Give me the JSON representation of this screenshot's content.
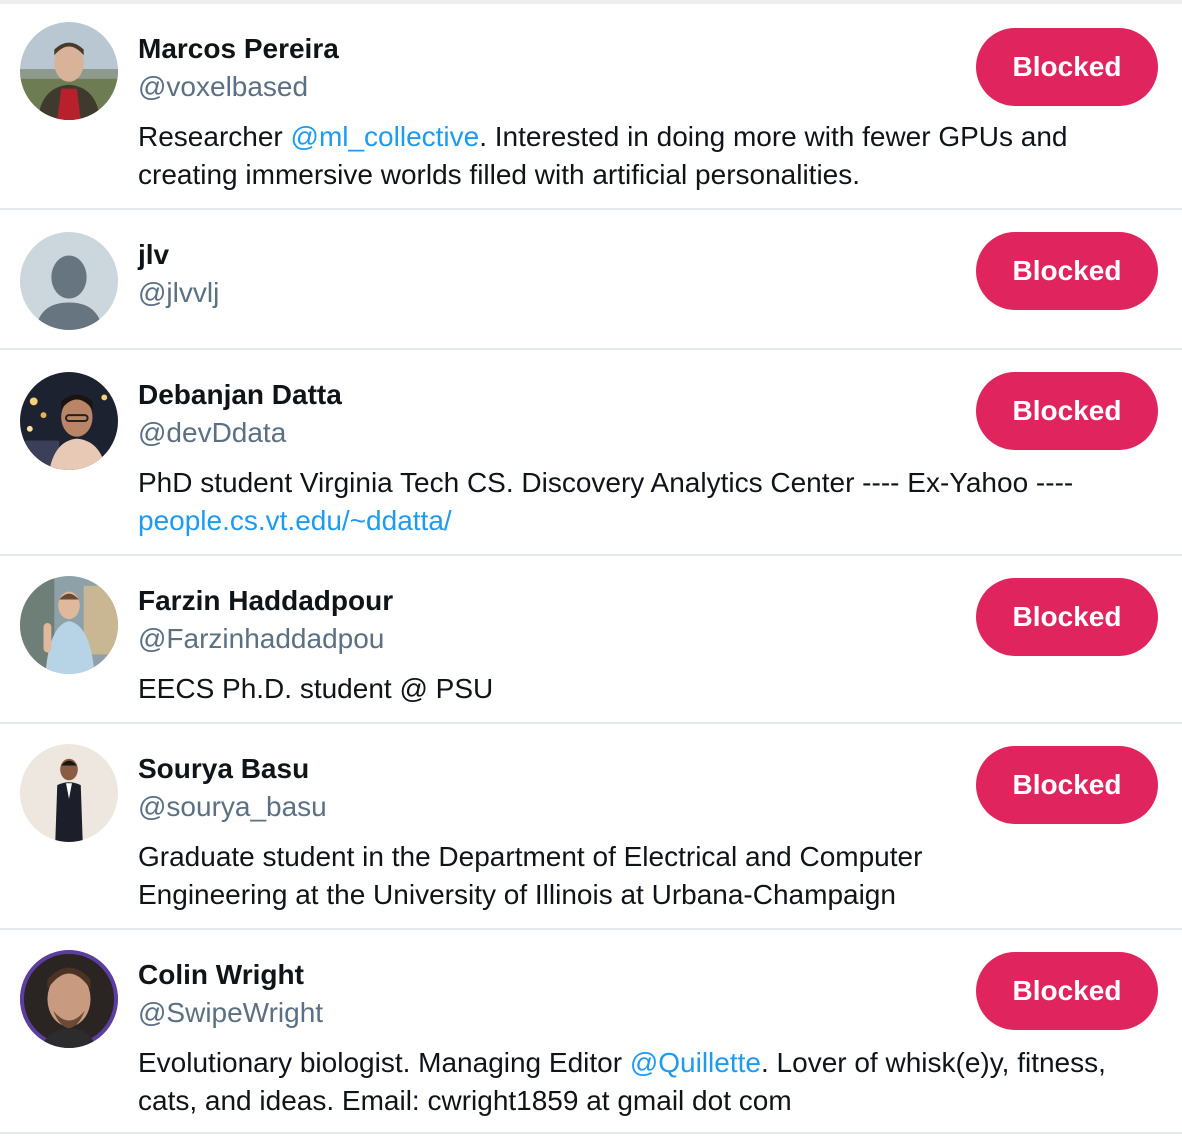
{
  "colors": {
    "blocked_button": "#e0245e",
    "link": "#1d9bf0",
    "handle": "#5b7083"
  },
  "users": [
    {
      "name": "Marcos Pereira",
      "handle": "@voxelbased",
      "avatar_icon": "user-photo-icon",
      "bio_parts": [
        {
          "text": "Researcher ",
          "link": false
        },
        {
          "text": "@ml_collective",
          "link": true
        },
        {
          "text": ". Interested in doing more with fewer GPUs and creating immersive worlds filled with artificial personalities.",
          "link": false
        }
      ],
      "button_label": "Blocked"
    },
    {
      "name": "jlv",
      "handle": "@jlvvlj",
      "avatar_icon": "default-avatar-icon",
      "bio_parts": [],
      "button_label": "Blocked"
    },
    {
      "name": "Debanjan Datta",
      "handle": "@devDdata",
      "avatar_icon": "user-photo-icon",
      "bio_parts": [
        {
          "text": "PhD student Virginia Tech CS. Discovery Analytics Center ---- Ex-Yahoo ---- ",
          "link": false
        },
        {
          "text": "people.cs.vt.edu/~ddatta/",
          "link": true
        }
      ],
      "button_label": "Blocked"
    },
    {
      "name": "Farzin Haddadpour",
      "handle": "@Farzinhaddadpou",
      "avatar_icon": "user-photo-icon",
      "bio_parts": [
        {
          "text": "EECS Ph.D. student @ PSU",
          "link": false
        }
      ],
      "button_label": "Blocked"
    },
    {
      "name": "Sourya Basu",
      "handle": "@sourya_basu",
      "avatar_icon": "user-photo-icon",
      "bio_parts": [
        {
          "text": "Graduate student in the Department of Electrical and Computer Engineering at the University of Illinois at Urbana-Champaign",
          "link": false
        }
      ],
      "button_label": "Blocked"
    },
    {
      "name": "Colin Wright",
      "handle": "@SwipeWright",
      "avatar_icon": "user-photo-icon",
      "bio_parts": [
        {
          "text": "Evolutionary biologist. Managing Editor ",
          "link": false
        },
        {
          "text": "@Quillette",
          "link": true
        },
        {
          "text": ". Lover of whisk(e)y, fitness, cats, and ideas. Email: cwright1859 at gmail dot com",
          "link": false
        }
      ],
      "button_label": "Blocked"
    }
  ]
}
